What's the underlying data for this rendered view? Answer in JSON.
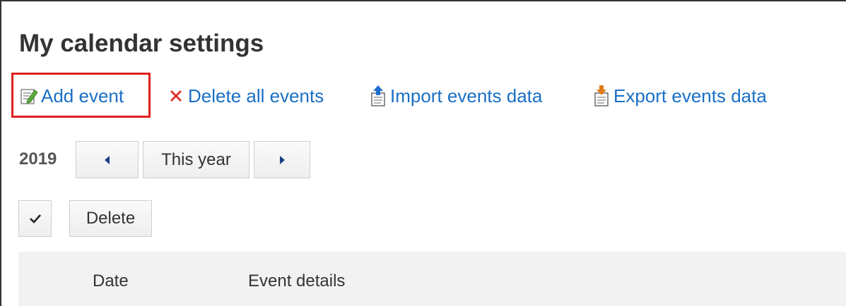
{
  "page": {
    "title": "My calendar settings"
  },
  "actions": {
    "add_event": "Add event",
    "delete_all": "Delete all events",
    "import": "Import events data",
    "export": "Export events data"
  },
  "nav": {
    "year": "2019",
    "prev_icon": "caret-left-icon",
    "this_year": "This year",
    "next_icon": "caret-right-icon"
  },
  "list_controls": {
    "check_icon": "checkmark-icon",
    "delete": "Delete"
  },
  "table": {
    "columns": [
      "Date",
      "Event details"
    ]
  },
  "colors": {
    "link": "#1a6fc4",
    "highlight": "#e02020",
    "delete_icon": "#e0302a",
    "import_icon": "#1f6fd0",
    "export_icon": "#e07a1a",
    "header_bg": "#f2f2f2"
  },
  "icons": {
    "add_event": "edit-note-icon",
    "delete_all": "red-x-icon",
    "import": "upload-document-icon",
    "export": "download-document-icon"
  }
}
